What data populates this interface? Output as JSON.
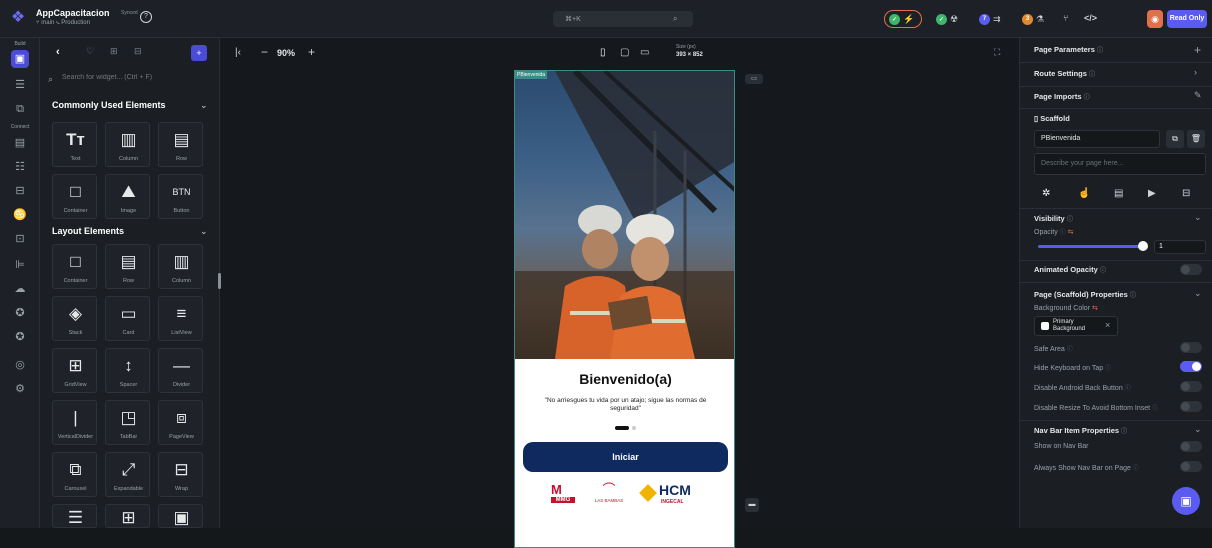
{
  "topbar": {
    "app_logo": "flutterflow-icon",
    "project_name": "AppCapacitacion",
    "synced": "Synced",
    "branch": "main",
    "environment": "Production",
    "command_shortcut": "⌘+K",
    "read_only_label": "Read Only"
  },
  "rail": {
    "build_label": "Build",
    "connect_label": "Connect"
  },
  "widgets": {
    "search_placeholder": "Search for widget... (Ctrl + F)",
    "common_title": "Commonly Used Elements",
    "common_items": [
      "Text",
      "Column",
      "Row",
      "Container",
      "Image",
      "Button"
    ],
    "layout_title": "Layout Elements",
    "layout_items": [
      "Container",
      "Row",
      "Column",
      "Stack",
      "Card",
      "ListView",
      "GridView",
      "Spacer",
      "Divider",
      "VerticalDivider",
      "TabBar",
      "PageView",
      "Carousel",
      "Expandable",
      "Wrap"
    ]
  },
  "canvas": {
    "zoom": "90%",
    "size_label": "Size (px)",
    "size_value": "393 × 852",
    "page_tag": "PBienvenida"
  },
  "phone": {
    "title": "Bienvenido(a)",
    "quote": "\"No arriesgues tu vida por un atajo; sigue las normas de seguridad\"",
    "button_label": "Iniciar",
    "logo_mmg": "MMG",
    "logo_lasbambas": "LAS BAMBAS",
    "logo_hcm": "HCM",
    "logo_hcm_sub": "INGECAL"
  },
  "right": {
    "page_parameters": "Page Parameters",
    "route_settings": "Route Settings",
    "page_imports": "Page Imports",
    "scaffold": "Scaffold",
    "page_name": "PBienvenida",
    "description_placeholder": "Describe your page here...",
    "visibility": "Visibility",
    "opacity_label": "Opacity",
    "opacity_value": "1",
    "opacity_fraction": 1,
    "animated_opacity": "Animated Opacity",
    "scaffold_props": "Page (Scaffold) Properties",
    "background_color": "Background Color",
    "bg_value_1": "Primary",
    "bg_value_2": "Background",
    "safe_area": "Safe Area",
    "hide_keyboard": "Hide Keyboard on Tap",
    "disable_back": "Disable Android Back Button",
    "disable_resize": "Disable Resize To Avoid Bottom Inset",
    "nav_props": "Nav Bar Item Properties",
    "show_nav": "Show on Nav Bar",
    "always_show_nav": "Always Show Nav Bar on Page"
  },
  "colors": {
    "accent": "#5a5cf0",
    "button_navy": "#0e2a5e",
    "page_tag": "#3e8a86"
  }
}
